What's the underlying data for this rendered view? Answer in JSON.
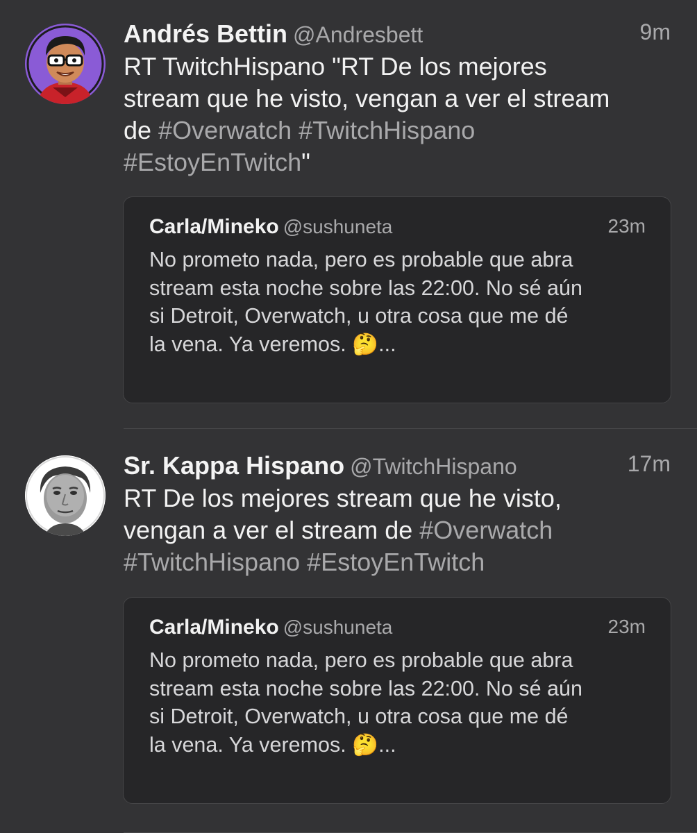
{
  "timeline": {
    "tweets": [
      {
        "author_name": "Andrés Bettin",
        "author_handle": "@Andresbett",
        "time": "9m",
        "avatar_icon": "cartoon-avatar-icon",
        "text_lines": [
          "RT TwitchHispano \"RT De los mejores",
          "stream que he visto, vengan a ver el stream",
          "de ",
          "#Overwatch",
          " ",
          "#TwitchHispano",
          "#EstoyEnTwitch",
          "\""
        ],
        "quote": {
          "author_name": "Carla/Mineko",
          "author_handle": "@sushuneta",
          "time": "23m",
          "text_lines": [
            "No prometo nada, pero es probable que abra",
            "stream esta noche sobre las 22:00. No sé aún",
            "si Detroit, Overwatch, u otra cosa que me dé",
            "la vena. Ya veremos. 🤔..."
          ]
        }
      },
      {
        "author_name": "Sr. Kappa Hispano",
        "author_handle": "@TwitchHispano",
        "time": "17m",
        "avatar_icon": "kappa-face-avatar-icon",
        "text_lines": [
          "RT De los mejores stream que he visto,",
          "vengan a ver el stream de ",
          "#Overwatch",
          "#TwitchHispano",
          " ",
          "#EstoyEnTwitch"
        ],
        "quote": {
          "author_name": "Carla/Mineko",
          "author_handle": "@sushuneta",
          "time": "23m",
          "text_lines": [
            "No prometo nada, pero es probable que abra",
            "stream esta noche sobre las 22:00. No sé aún",
            "si Detroit, Overwatch, u otra cosa que me dé",
            "la vena. Ya veremos. 🤔..."
          ]
        }
      }
    ]
  },
  "colors": {
    "background": "#333335",
    "quote_background": "#262628",
    "secondary_text": "#a9a9ab",
    "primary_text": "#f2f2f2"
  }
}
